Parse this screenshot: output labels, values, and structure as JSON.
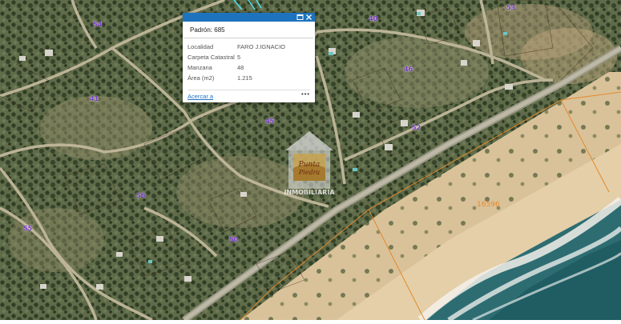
{
  "popup": {
    "title_label": "Padrón:",
    "title_value": "685",
    "fields": [
      {
        "key": "Localidad",
        "value": "FARO J.IGNACIO"
      },
      {
        "key": "Carpeta Catastral",
        "value": "5"
      },
      {
        "key": "Manzana",
        "value": "48"
      },
      {
        "key": "Área (m2)",
        "value": "1.215"
      }
    ],
    "zoom_link": "Acercar a",
    "more_label": "•••"
  },
  "map_labels": [
    {
      "text": "54",
      "name": "block-label-54a"
    },
    {
      "text": "40",
      "name": "block-label-40"
    },
    {
      "text": "53",
      "name": "block-label-53"
    },
    {
      "text": "41",
      "name": "block-label-41"
    },
    {
      "text": "46",
      "name": "block-label-46"
    },
    {
      "text": "45",
      "name": "block-label-45"
    },
    {
      "text": "52",
      "name": "block-label-52"
    },
    {
      "text": "56",
      "name": "block-label-56"
    },
    {
      "text": "55",
      "name": "block-label-55"
    },
    {
      "text": "50",
      "name": "block-label-50"
    }
  ],
  "parcel_label": "16596",
  "watermark_text": "INMOBILIARIA",
  "watermark_logo_text": "Punta Piedra",
  "colors": {
    "popup_titlebar": "#1e73be",
    "block_label": "#7a3cc8",
    "parcel_line": "#e38a2c",
    "ocean": "#1f5d63",
    "beach": "#e4cfa9",
    "vegetation": "#4c5e3a"
  }
}
